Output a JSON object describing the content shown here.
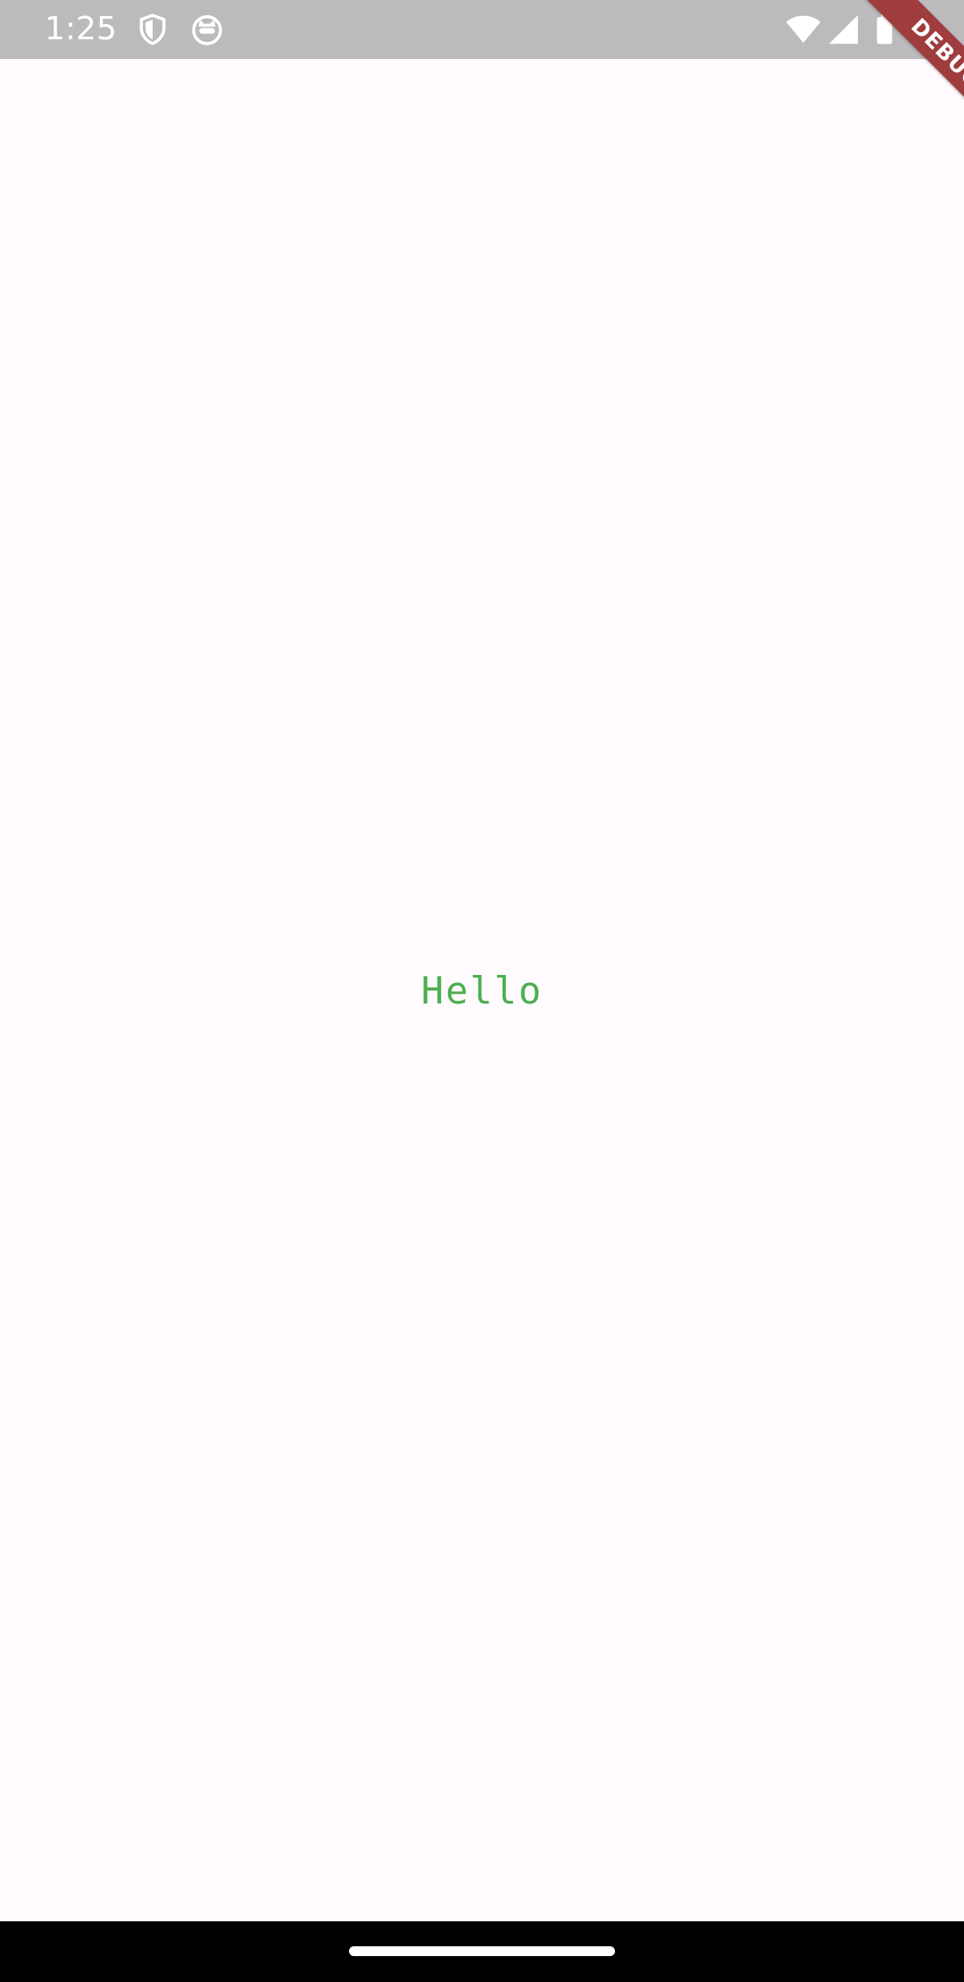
{
  "status_bar": {
    "time": "1:25",
    "background_color": "#bcbabd",
    "left_icons": [
      "shield-icon",
      "cat-face-icon"
    ],
    "right_icons": [
      "wifi-icon",
      "signal-icon",
      "battery-icon"
    ]
  },
  "debug_banner": {
    "label": "DEBUG",
    "color": "#9f3c3d"
  },
  "main": {
    "text": "Hello",
    "text_color": "#4caf50",
    "background_color": "#fffbfe"
  },
  "nav_bar": {
    "home_indicator_icon": "home-handle-icon"
  }
}
